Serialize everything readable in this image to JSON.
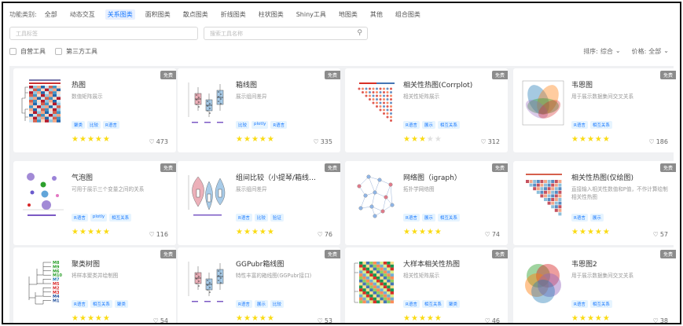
{
  "filter": {
    "label": "功能类别:",
    "categories": [
      "全部",
      "动态交互",
      "关系图类",
      "面积图类",
      "散点图类",
      "折线图类",
      "柱状图类",
      "Shiny工具",
      "地图类",
      "其他",
      "组合图类"
    ],
    "active_index": 2
  },
  "search": {
    "tool_placeholder": "工具标签",
    "name_placeholder": "搜索工具名称"
  },
  "checkboxes": [
    "自营工具",
    "第三方工具"
  ],
  "sort": {
    "label": "排序:",
    "value": "综合",
    "price_label": "价格:",
    "price_value": "全部"
  },
  "colors": {
    "star_on": "#fadb14",
    "star_off": "#e0e0e0",
    "tag_bg": "#e6f4ff",
    "tag_fg": "#1677ff",
    "active": "#1677ff"
  },
  "cards": [
    {
      "title": "热图",
      "desc": "数值矩阵展示",
      "tags": [
        "聚类",
        "比较",
        "R语言"
      ],
      "rating": 5,
      "likes": "473",
      "badge": "免费",
      "thumb": "heatmap-thumbnail"
    },
    {
      "title": "箱线图",
      "desc": "展示组间差异",
      "tags": [
        "比较",
        "plotly",
        "R语言"
      ],
      "rating": 5,
      "likes": "335",
      "badge": "免费",
      "thumb": "boxplot-thumbnail"
    },
    {
      "title": "相关性热图(Corrplot)",
      "desc": "相关性矩阵展示",
      "tags": [
        "R语言",
        "展示",
        "相互关系"
      ],
      "rating": 3,
      "likes": "312",
      "badge": "免费",
      "thumb": "corrplot-thumbnail"
    },
    {
      "title": "韦恩图",
      "desc": "用于展示数据集间交叉关系",
      "tags": [
        "R语言",
        "相互关系"
      ],
      "rating": 5,
      "likes": "186",
      "badge": "免费",
      "thumb": "venn-thumbnail"
    },
    {
      "title": "气泡图",
      "desc": "可用于展示三个变量之间的关系",
      "tags": [
        "R语言",
        "plotly",
        "相互关系"
      ],
      "rating": 5,
      "likes": "116",
      "badge": "免费",
      "thumb": "bubble-thumbnail"
    },
    {
      "title": "组间比较（小提琴/箱线图）统计…",
      "desc": "展示组间差异",
      "tags": [
        "R语言",
        "比较",
        "验证"
      ],
      "rating": 5,
      "likes": "76",
      "badge": "免费",
      "thumb": "violin-thumbnail"
    },
    {
      "title": "网络图（igraph）",
      "desc": "拓扑学网络图",
      "tags": [
        "R语言",
        "展示",
        "相互关系"
      ],
      "rating": 5,
      "likes": "74",
      "badge": "免费",
      "thumb": "network-thumbnail"
    },
    {
      "title": "相关性热图(仅绘图)",
      "desc": "直接输入相关性数值和P值，不作计算绘制相关性热图",
      "tags": [
        "R语言",
        "展示"
      ],
      "rating": 5,
      "likes": "57",
      "badge": "免费",
      "thumb": "corr-heatmap-thumbnail"
    },
    {
      "title": "聚类树图",
      "desc": "将样本聚类并绘制图",
      "tags": [
        "R语言",
        "相互关系",
        "聚类"
      ],
      "rating": 5,
      "likes": "54",
      "badge": "免费",
      "thumb": "dendrogram-thumbnail"
    },
    {
      "title": "GGPubr箱线图",
      "desc": "特性丰富的箱线图(GGPubr接口)",
      "tags": [
        "R语言",
        "展示",
        "比较"
      ],
      "rating": 5,
      "likes": "53",
      "badge": "免费",
      "thumb": "ggpubr-boxplot-thumbnail"
    },
    {
      "title": "大样本相关性热图",
      "desc": "相关性矩阵展示",
      "tags": [
        "R语言",
        "相互关系",
        "聚类"
      ],
      "rating": 5,
      "likes": "46",
      "badge": "免费",
      "thumb": "large-corr-heatmap-thumbnail"
    },
    {
      "title": "韦恩图2",
      "desc": "用于展示数据集间交叉关系",
      "tags": [
        "R语言",
        "相互关系"
      ],
      "rating": 5,
      "likes": "38",
      "badge": "免费",
      "thumb": "venn2-thumbnail"
    }
  ]
}
